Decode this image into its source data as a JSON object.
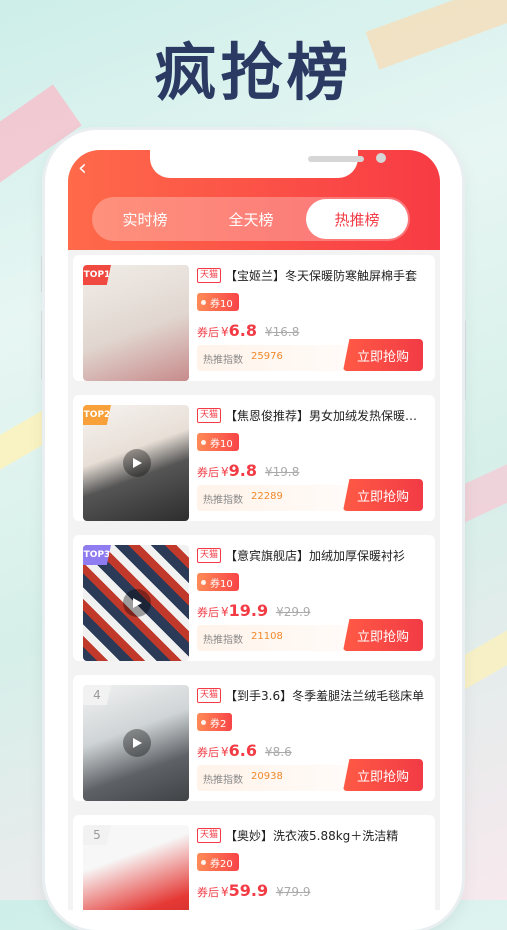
{
  "headline": "疯抢榜",
  "tabs": [
    {
      "label": "实时榜",
      "active": false
    },
    {
      "label": "全天榜",
      "active": false
    },
    {
      "label": "热推榜",
      "active": true
    }
  ],
  "badge_label": "天猫",
  "after_label": "券后",
  "yen": "¥",
  "hot_label": "热推指数",
  "buy_label": "立即抢购",
  "items": [
    {
      "rank": "TOP1",
      "title": "【宝姬兰】冬天保暖防寒触屏棉手套",
      "coupon": "券10",
      "price": "6.8",
      "orig": "¥16.8",
      "hot": "25976",
      "video": false
    },
    {
      "rank": "TOP2",
      "title": "【焦恩俊推荐】男女加绒发热保暖内衣",
      "coupon": "券10",
      "price": "9.8",
      "orig": "¥19.8",
      "hot": "22289",
      "video": true
    },
    {
      "rank": "TOP3",
      "title": "【意宾旗舰店】加绒加厚保暖衬衫",
      "coupon": "券10",
      "price": "19.9",
      "orig": "¥29.9",
      "hot": "21108",
      "video": true
    },
    {
      "rank": "4",
      "title": "【到手3.6】冬季羞腿法兰绒毛毯床单",
      "coupon": "券2",
      "price": "6.6",
      "orig": "¥8.6",
      "hot": "20938",
      "video": true
    },
    {
      "rank": "5",
      "title": "【奥妙】洗衣液5.88kg＋洗洁精",
      "coupon": "券20",
      "price": "59.9",
      "orig": "¥79.9",
      "hot": "",
      "video": false
    }
  ]
}
